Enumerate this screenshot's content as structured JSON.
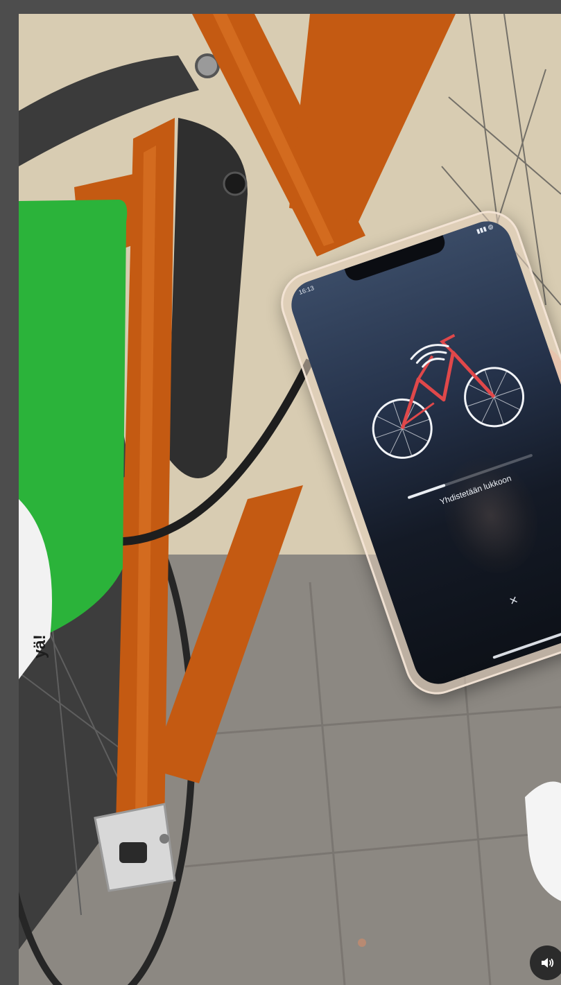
{
  "phone": {
    "status_time": "16:13",
    "status_icons": "▮▮▮ ◍",
    "connecting_label": "Yhdistetään lukkoon",
    "progress": 0.3,
    "close_label": "×"
  },
  "sign": {
    "text": "yä!"
  },
  "player": {
    "volume_icon": "speaker-icon"
  },
  "colors": {
    "bike_frame": "#c45a12",
    "sign_green": "#2bb33a",
    "app_accent": "#e0484a"
  }
}
